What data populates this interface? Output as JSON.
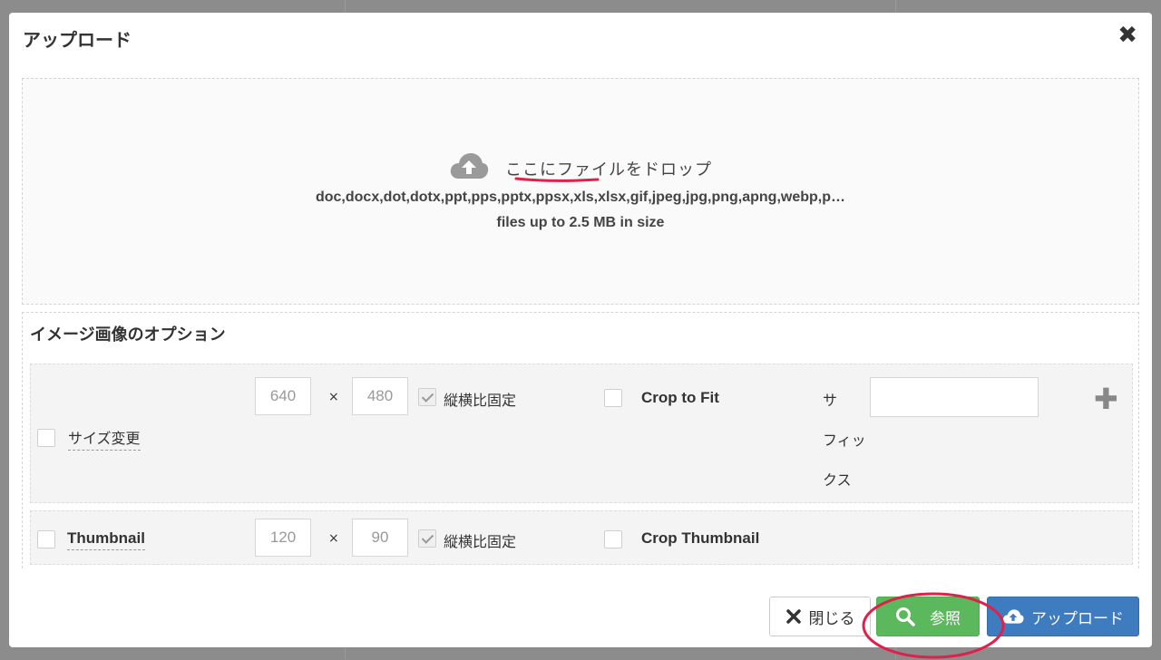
{
  "dialog": {
    "title": "アップロード",
    "close_symbol": "✖"
  },
  "dropzone": {
    "icon": "cloud-upload-icon",
    "drop_text": "ここにファイルをドロップ",
    "extensions": "doc,docx,dot,dotx,ppt,pps,pptx,ppsx,xls,xlsx,gif,jpeg,jpg,png,apng,webp,p…",
    "size_limit": "files up to 2.5 MB in size"
  },
  "image_options": {
    "title": "イメージ画像のオプション",
    "resize": {
      "label": "サイズ変更",
      "checked": false,
      "width": "640",
      "height": "480",
      "times": "×",
      "keep_ratio_label": "縦横比固定",
      "keep_ratio_checked": true,
      "crop_label": "Crop to Fit",
      "crop_checked": false,
      "suffix_label_lines": [
        "サ",
        "フィッ",
        "クス"
      ],
      "suffix_value": "",
      "add_symbol": "✚"
    },
    "thumbnail": {
      "label": "Thumbnail",
      "checked": false,
      "width": "120",
      "height": "90",
      "times": "×",
      "keep_ratio_label": "縦横比固定",
      "keep_ratio_checked": true,
      "crop_label": "Crop Thumbnail",
      "crop_checked": false
    }
  },
  "footer": {
    "close_label": "閉じる",
    "browse_label": "参照",
    "upload_label": "アップロード"
  },
  "colors": {
    "browse_green": "#5cb85c",
    "upload_blue": "#3f7cbf",
    "annotation_red": "#e0204a"
  }
}
